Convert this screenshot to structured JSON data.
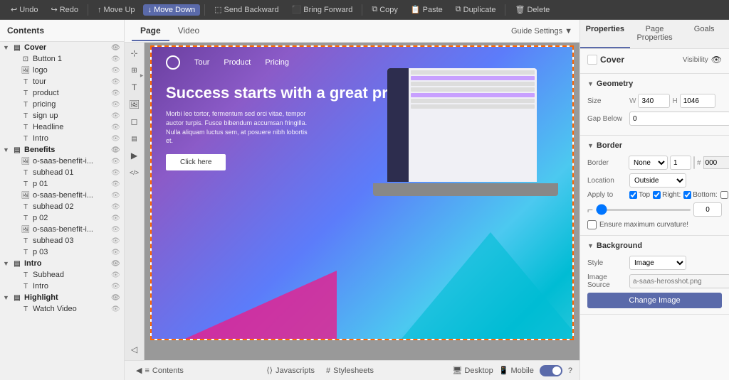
{
  "toolbar": {
    "undo_label": "Undo",
    "redo_label": "Redo",
    "move_up_label": "Move Up",
    "move_down_label": "Move Down",
    "send_backward_label": "Send Backward",
    "bring_forward_label": "Bring Forward",
    "copy_label": "Copy",
    "paste_label": "Paste",
    "duplicate_label": "Duplicate",
    "delete_label": "Delete"
  },
  "left_panel": {
    "header": "Contents",
    "tree": [
      {
        "id": "cover",
        "level": 0,
        "type": "folder",
        "label": "Cover",
        "expanded": true
      },
      {
        "id": "button1",
        "level": 1,
        "type": "button",
        "label": "Button 1"
      },
      {
        "id": "logo",
        "level": 1,
        "type": "image",
        "label": "logo"
      },
      {
        "id": "tour",
        "level": 1,
        "type": "text",
        "label": "tour"
      },
      {
        "id": "product",
        "level": 1,
        "type": "text",
        "label": "product"
      },
      {
        "id": "pricing",
        "level": 1,
        "type": "text",
        "label": "pricing"
      },
      {
        "id": "signup",
        "level": 1,
        "type": "text",
        "label": "sign up"
      },
      {
        "id": "headline",
        "level": 1,
        "type": "text",
        "label": "Headline"
      },
      {
        "id": "intro",
        "level": 1,
        "type": "text",
        "label": "Intro"
      },
      {
        "id": "benefits",
        "level": 0,
        "type": "folder",
        "label": "Benefits",
        "expanded": true
      },
      {
        "id": "benefit1",
        "level": 1,
        "type": "image",
        "label": "o-saas-benefit-i..."
      },
      {
        "id": "subhead01",
        "level": 1,
        "type": "text",
        "label": "subhead 01"
      },
      {
        "id": "p01",
        "level": 1,
        "type": "text",
        "label": "p 01"
      },
      {
        "id": "benefit2",
        "level": 1,
        "type": "image",
        "label": "o-saas-benefit-i..."
      },
      {
        "id": "subhead02",
        "level": 1,
        "type": "text",
        "label": "subhead 02"
      },
      {
        "id": "p02",
        "level": 1,
        "type": "text",
        "label": "p 02"
      },
      {
        "id": "benefit3",
        "level": 1,
        "type": "image",
        "label": "o-saas-benefit-i..."
      },
      {
        "id": "subhead03",
        "level": 1,
        "type": "text",
        "label": "subhead 03"
      },
      {
        "id": "p03",
        "level": 1,
        "type": "text",
        "label": "p 03"
      },
      {
        "id": "intro2",
        "level": 0,
        "type": "folder",
        "label": "Intro",
        "expanded": true
      },
      {
        "id": "subhead",
        "level": 1,
        "type": "text",
        "label": "Subhead"
      },
      {
        "id": "intro3",
        "level": 1,
        "type": "text",
        "label": "Intro"
      },
      {
        "id": "highlight",
        "level": 0,
        "type": "folder",
        "label": "Highlight",
        "expanded": true
      },
      {
        "id": "watchvideo",
        "level": 1,
        "type": "text",
        "label": "Watch Video"
      }
    ]
  },
  "center": {
    "tabs": [
      {
        "id": "page",
        "label": "Page",
        "active": true
      },
      {
        "id": "video",
        "label": "Video",
        "active": false
      }
    ],
    "guide_settings": "Guide Settings",
    "page_content": {
      "nav_links": [
        "Tour",
        "Product",
        "Pricing"
      ],
      "hero_title": "Success starts with a great product",
      "hero_body": "Morbi leo tortor, fermentum sed orci vitae, tempor auctor turpis. Fusce bibendum accumsan fringilla. Nulla aliquam luctus sem, at posuere nibh lobortis et.",
      "cta_button": "Click here"
    }
  },
  "bottom_bar": {
    "prev_label": "Contents",
    "next_sections": [
      "Javascripts",
      "Stylesheets"
    ],
    "desktop_label": "Desktop",
    "mobile_label": "Mobile",
    "toggle_on": true,
    "help_label": "?"
  },
  "right_panel": {
    "tabs": [
      "Properties",
      "Page Properties",
      "Goals"
    ],
    "active_tab": "Properties",
    "cover_section": {
      "title": "Cover",
      "visibility_label": "Visibility"
    },
    "geometry_section": {
      "title": "Geometry",
      "size_label": "Size",
      "w_label": "W",
      "w_value": "340",
      "h_label": "H",
      "h_value": "1046",
      "gap_below_label": "Gap Below",
      "gap_below_value": "0"
    },
    "border_section": {
      "title": "Border",
      "border_label": "Border",
      "border_style": "None",
      "border_width": "1",
      "color_hex": "000",
      "location_label": "Location",
      "location_value": "Outside",
      "apply_to_label": "Apply to",
      "apply_top": true,
      "apply_right": true,
      "apply_bottom": true,
      "apply_left": false,
      "corner_radius_label": "Corner Radius",
      "corner_radius_value": "0",
      "ensure_curvature_label": "Ensure maximum curvature!"
    },
    "background_section": {
      "title": "Background",
      "style_label": "Style",
      "style_value": "Image",
      "image_source_label": "Image Source",
      "image_source_placeholder": "a-saas-herosshot.png",
      "change_image_label": "Change Image"
    }
  }
}
